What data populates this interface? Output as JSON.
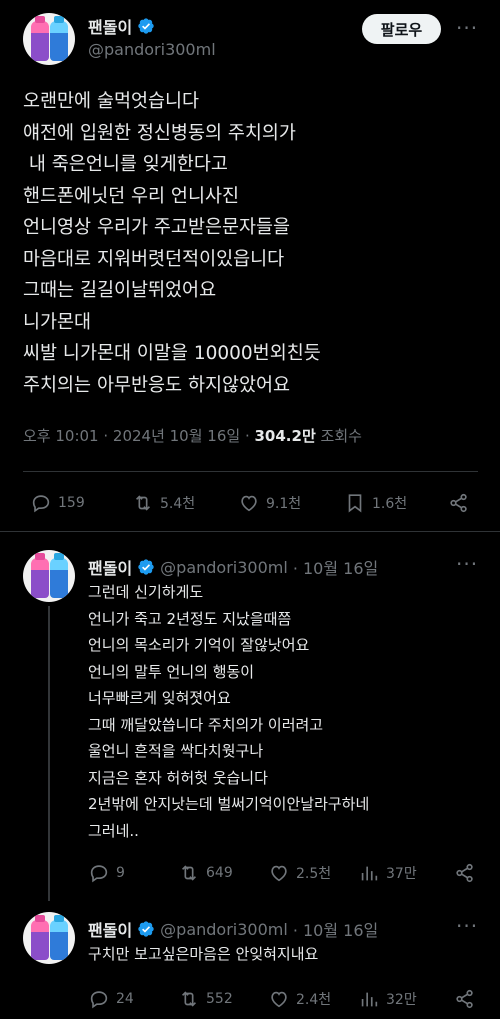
{
  "main_post": {
    "display_name": "팬돌이",
    "handle": "@pandori300ml",
    "follow_label": "팔로우",
    "more": "···",
    "lines": [
      "오랜만에 술먹엇습니다",
      "얘전에 입원한 정신병동의 주치의가",
      " 내 죽은언니를 잊게한다고",
      "핸드폰에닛던 우리 언니사진",
      "언니영상 우리가 주고받은문자들을",
      "마음대로 지워버렷던적이있읍니다",
      "그때는 길길이날뛰었어요",
      "니가몬대",
      "씨발 니가몬대 이말을 10000번외친듯",
      "주치의는 아무반응도 하지않았어요"
    ],
    "time": "오후 10:01 · 2024년 10월 16일 · ",
    "views": "304.2만",
    "views_label": " 조회수",
    "replies": "159",
    "reposts": "5.4천",
    "likes": "9.1천",
    "bookmarks": "1.6천"
  },
  "reply1": {
    "display_name": "팬돌이",
    "handle": "@pandori300ml",
    "date": "· 10월 16일",
    "more": "···",
    "lines": [
      "그런데 신기하게도",
      "언니가 죽고 2년정도 지났을때쯤",
      "언니의 목소리가 기억이 잘않낫어요",
      "언니의 말투 언니의 행동이",
      "너무빠르게 잊혀졋어요",
      "그때 깨달았씁니다 주치의가 이러려고",
      "울언니 흔적을 싹다치웟구나",
      "지금은 혼자 허허헛 웃습니다",
      "2년밖에 안지낫는데 벌써기억이안날라구하네",
      "그러네.."
    ],
    "replies": "9",
    "reposts": "649",
    "likes": "2.5천",
    "views": "37만"
  },
  "reply2": {
    "display_name": "팬돌이",
    "handle": "@pandori300ml",
    "date": "· 10월 16일",
    "more": "···",
    "lines": [
      "구치만 보고싶은마음은 안잊혀지내요"
    ],
    "replies": "24",
    "reposts": "552",
    "likes": "2.4천",
    "views": "32만"
  },
  "colors": {
    "verified": "#1d9bf0",
    "text": "#e7e9ea",
    "muted": "#71767b",
    "border": "#2f3336"
  }
}
